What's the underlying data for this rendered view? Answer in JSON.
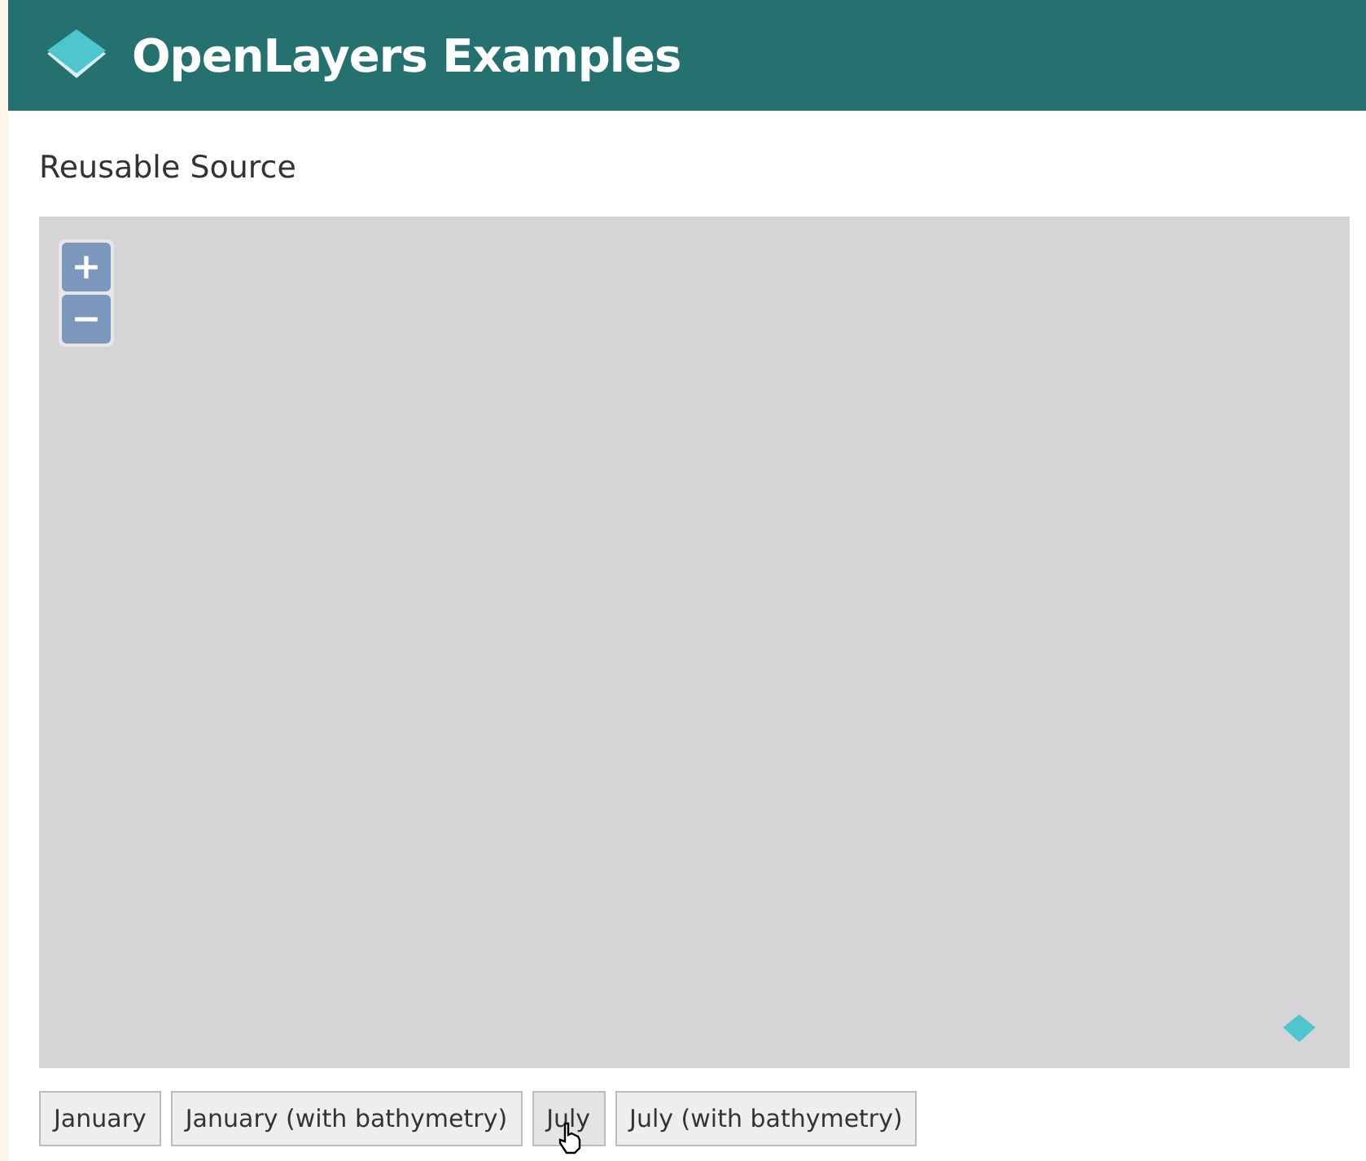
{
  "header": {
    "title": "OpenLayers Examples"
  },
  "example": {
    "title": "Reusable Source"
  },
  "map": {
    "zoom_controls": [
      "+",
      "−"
    ]
  },
  "buttons": [
    {
      "label": "January",
      "hovered": false
    },
    {
      "label": "January (with bathymetry)",
      "hovered": false
    },
    {
      "label": "July",
      "hovered": true
    },
    {
      "label": "July (with bathymetry)",
      "hovered": false
    }
  ]
}
